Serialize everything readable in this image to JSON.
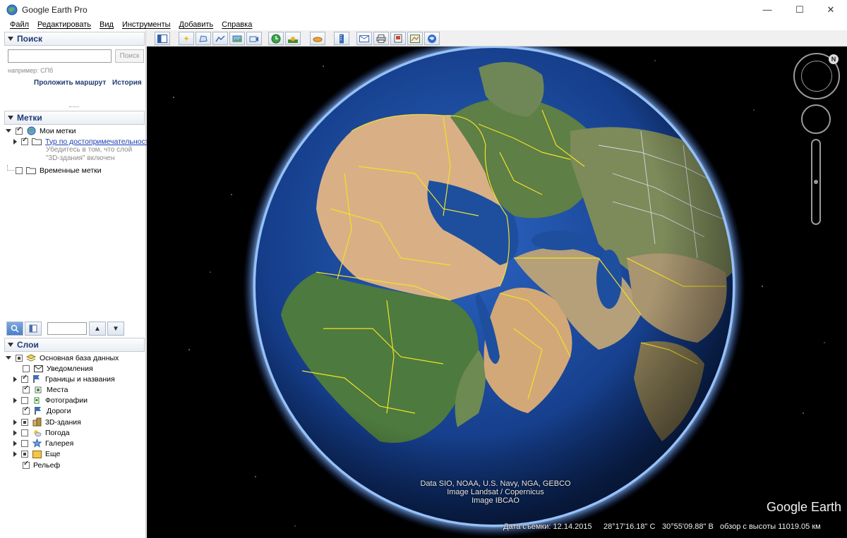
{
  "window": {
    "title": "Google Earth Pro"
  },
  "menu": [
    "Файл",
    "Редактировать",
    "Вид",
    "Инструменты",
    "Добавить",
    "Справка"
  ],
  "search": {
    "header": "Поиск",
    "placeholder": "",
    "button": "Поиск",
    "hint": "например: СПб",
    "route_link": "Проложить маршрут",
    "history_link": "История"
  },
  "places": {
    "header": "Метки",
    "items": [
      {
        "label": "Мои метки",
        "checked": true
      },
      {
        "label": "Тур по достопримечательност",
        "note_line1": "Убедитесь в том, что слой",
        "note_line2": "\"3D-здания\" включен"
      },
      {
        "label": "Временные метки",
        "checked": false
      }
    ]
  },
  "layers": {
    "header": "Слои",
    "items": [
      {
        "label": "Основная база данных",
        "icon": "layers-stack-icon"
      },
      {
        "label": "Уведомления",
        "icon": "envelope-icon"
      },
      {
        "label": "Границы и названия",
        "icon": "flag-icon"
      },
      {
        "label": "Места",
        "icon": "places-icon"
      },
      {
        "label": "Фотографии",
        "icon": "photo-icon"
      },
      {
        "label": "Дороги",
        "icon": "road-flag-icon"
      },
      {
        "label": "3D-здания",
        "icon": "building-icon"
      },
      {
        "label": "Погода",
        "icon": "weather-icon"
      },
      {
        "label": "Галерея",
        "icon": "gallery-star-icon"
      },
      {
        "label": "Еще",
        "icon": "folder-icon"
      },
      {
        "label": "Рельеф",
        "icon": ""
      }
    ]
  },
  "view": {
    "attribution_line1": "Data SIO, NOAA, U.S. Navy, NGA, GEBCO",
    "attribution_line2": "Image Landsat / Copernicus",
    "attribution_line3": "Image IBCAO",
    "brand": "Google Earth",
    "status": {
      "date": "Дата съемки: 12.14.2015",
      "lat": "28°17'16.18\" С",
      "lon": "30°55'09.88\" В",
      "altitude": "обзор с высоты 11019.05 км"
    }
  },
  "colors": {
    "panel_title": "#1f3b73",
    "border_yellow": "#f2e227",
    "border_white": "#d9d9e6",
    "ocean": "#1f4ea8"
  }
}
